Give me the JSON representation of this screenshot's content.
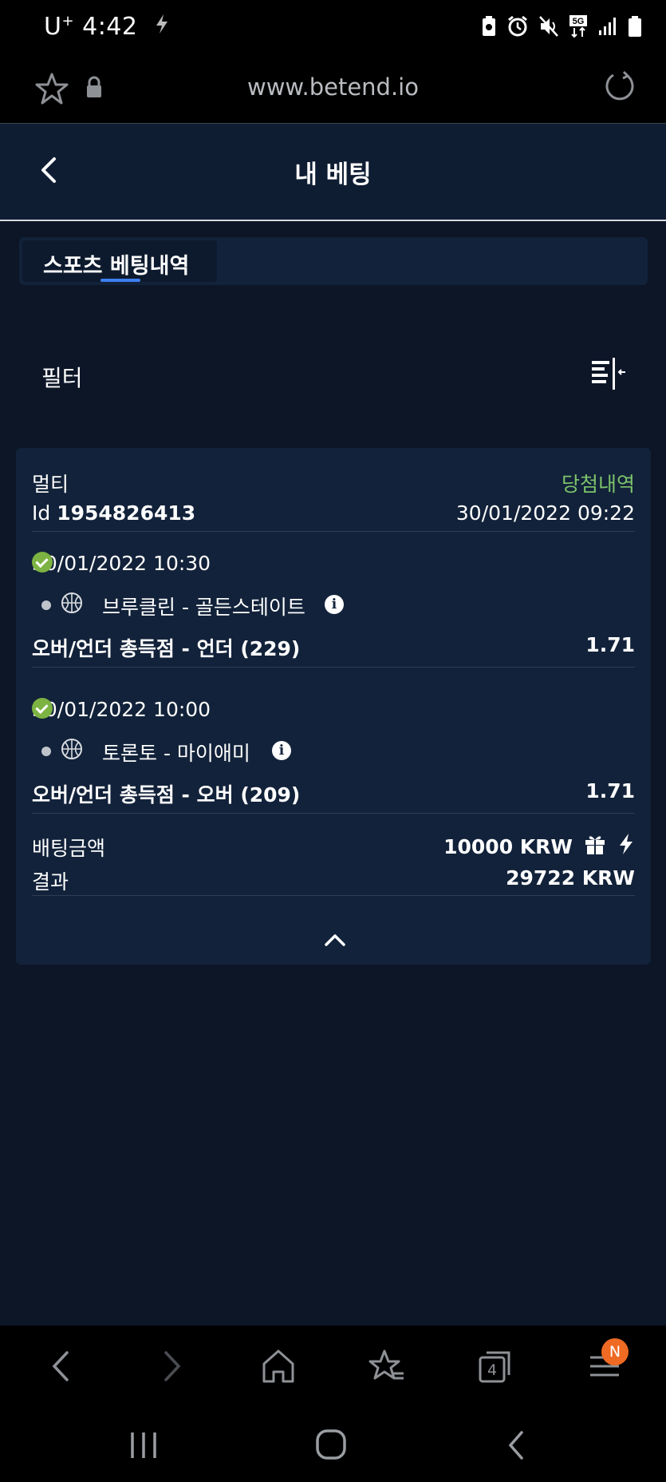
{
  "status_bar": {
    "carrier": "U",
    "carrier_sup": "+",
    "time": "4:42",
    "icons": [
      "bolt-icon",
      "battery-saver-icon",
      "alarm-icon",
      "mute-icon",
      "5g-icon",
      "signal-icon",
      "battery-icon"
    ]
  },
  "browser": {
    "url": "www.betend.io",
    "icons": [
      "star-icon",
      "lock-icon",
      "reload-icon"
    ]
  },
  "header": {
    "title": "내 베팅"
  },
  "tabs": [
    {
      "label": "스포츠 베팅내역",
      "active": true
    }
  ],
  "filter": {
    "label": "필터"
  },
  "bet": {
    "type": "멀티",
    "status": "당첨내역",
    "status_color": "#7cc36b",
    "id_label": "Id",
    "id_value": "1954826413",
    "placed_at": "30/01/2022 09:22",
    "selections": [
      {
        "datetime": "30/01/2022 10:30",
        "match": "브루클린 - 골든스테이트",
        "market": "오버/언더 총득점 - 언더 (229)",
        "odds": "1.71",
        "result": "won"
      },
      {
        "datetime": "30/01/2022 10:00",
        "match": "토론토 - 마이애미",
        "market": "오버/언더 총득점 - 오버 (209)",
        "odds": "1.71",
        "result": "won"
      }
    ],
    "stake_label": "배팅금액",
    "stake_value": "10000 KRW",
    "result_label": "결과",
    "result_value": "29722 KRW"
  },
  "bottom_nav": {
    "items": [
      "back-icon",
      "forward-icon",
      "home-icon",
      "bookmarks-icon",
      "tabs-icon",
      "menu-icon"
    ],
    "tabs_count": "4",
    "menu_badge": "N"
  }
}
